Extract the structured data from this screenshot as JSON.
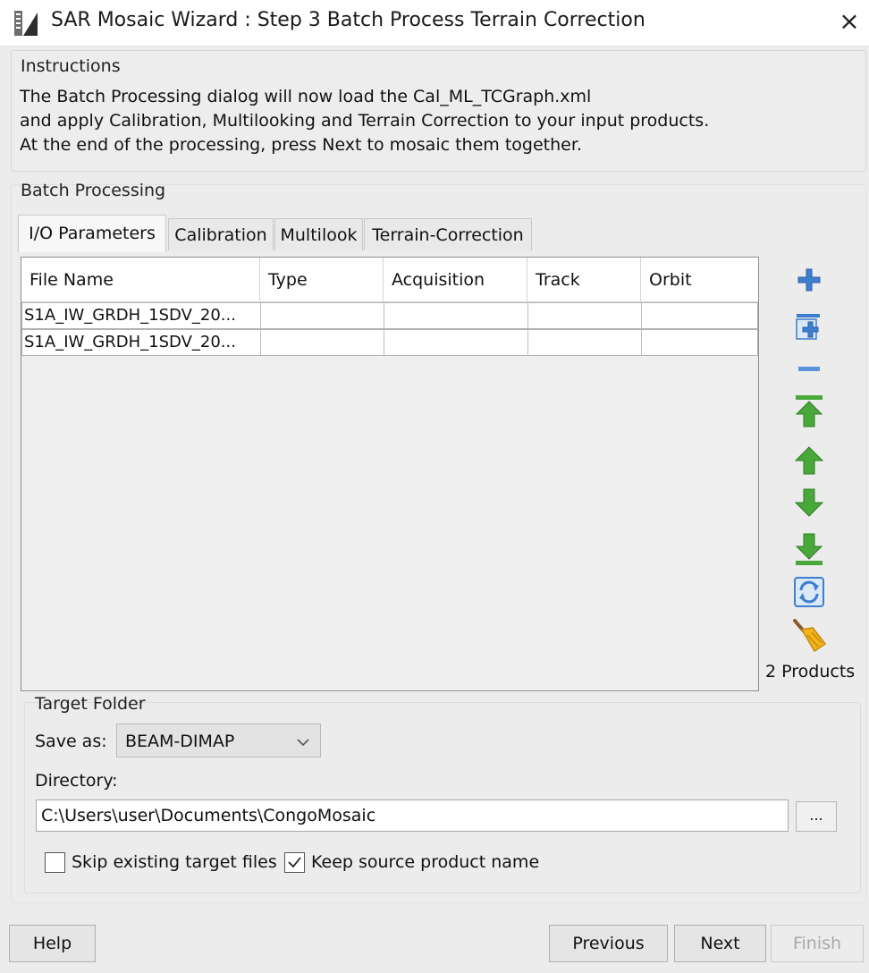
{
  "window": {
    "title": "SAR Mosaic Wizard : Step 3 Batch Process Terrain Correction",
    "close_glyph": "×"
  },
  "instructions": {
    "legend": "Instructions",
    "lines": [
      "The Batch Processing dialog will now load the Cal_ML_TCGraph.xml",
      "and apply Calibration, Multilooking and Terrain Correction to your input products.",
      "At the end of the processing, press Next to mosaic them together."
    ]
  },
  "batch": {
    "legend": "Batch Processing",
    "tabs": [
      {
        "label": "I/O Parameters",
        "active": true
      },
      {
        "label": "Calibration",
        "active": false
      },
      {
        "label": "Multilook",
        "active": false
      },
      {
        "label": "Terrain-Correction",
        "active": false
      }
    ],
    "table": {
      "columns": [
        "File Name",
        "Type",
        "Acquisition",
        "Track",
        "Orbit"
      ],
      "rows": [
        [
          "S1A_IW_GRDH_1SDV_20...",
          "",
          "",
          "",
          ""
        ],
        [
          "S1A_IW_GRDH_1SDV_20...",
          "",
          "",
          "",
          ""
        ]
      ]
    },
    "toolbar": {
      "icons": [
        "add-icon",
        "add-opened-icon",
        "remove-icon",
        "move-top-icon",
        "move-up-icon",
        "move-down-icon",
        "move-bottom-icon",
        "refresh-icon",
        "clear-icon"
      ],
      "products_label": "2 Products"
    }
  },
  "target": {
    "legend": "Target Folder",
    "save_as_label": "Save as:",
    "format": "BEAM-DIMAP",
    "directory_label": "Directory:",
    "directory": "C:\\Users\\user\\Documents\\CongoMosaic",
    "browse_label": "...",
    "skip_existing_label": "Skip existing target files",
    "skip_existing_checked": false,
    "keep_name_label": "Keep source product name",
    "keep_name_checked": true
  },
  "buttons": {
    "help": "Help",
    "previous": "Previous",
    "next": "Next",
    "finish": "Finish"
  },
  "colors": {
    "icon_blue": "#3d7ecf",
    "icon_green": "#49a83a",
    "broom_yellow": "#f2b51c"
  }
}
